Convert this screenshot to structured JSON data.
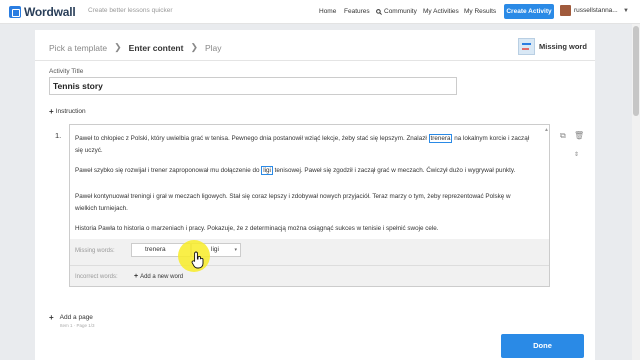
{
  "header": {
    "logo_text": "Wordwall",
    "tagline": "Create better lessons quicker",
    "nav": [
      "Home",
      "Features",
      "Community",
      "My Activities",
      "My Results"
    ],
    "create_label": "Create Activity",
    "username": "russellstanna...",
    "search_icon": "search-icon",
    "accent_color": "#2a8ae6"
  },
  "breadcrumb": [
    "Pick a template",
    "Enter content",
    "Play"
  ],
  "template_type": "Missing word",
  "activity": {
    "title_label": "Activity Title",
    "title_value": "Tennis story",
    "instruction_label": "Instruction"
  },
  "question": {
    "number": "1.",
    "paragraphs": [
      {
        "lines": [
          [
            {
              "text": "Paweł to chłopiec z Polski, który uwielbia grać w tenisa. Pewnego dnia postanowił wziąć lekcje, żeby stać się lepszym. Znalazł "
            },
            {
              "text": "trenera",
              "blank": true
            },
            {
              "text": " na lokalnym korcie i zaczął"
            }
          ],
          [
            {
              "text": "się uczyć."
            }
          ]
        ]
      },
      {
        "lines": [
          [
            {
              "text": "Paweł szybko się rozwijał i trener zaproponował mu dołączenie do "
            },
            {
              "text": "ligi",
              "blank": true
            },
            {
              "text": " tenisowej. Paweł się zgodził i zaczął grać w meczach. Ćwiczył dużo i wygrywał punkty."
            }
          ]
        ]
      },
      {
        "lines": [
          [
            {
              "text": "Paweł kontynuował treningi i grał w meczach ligowych. Stał się coraz lepszy i zdobywał nowych przyjaciół. Teraz marzy o tym, żeby reprezentować Polskę w"
            }
          ],
          [
            {
              "text": "wielkich turniejach."
            }
          ]
        ]
      },
      {
        "lines": [
          [
            {
              "text": "Historia Pawła to historia o marzeniach i pracy. Pokazuje, że z determinacją można osiągnąć sukces w tenisie i spełnić swoje cele."
            }
          ]
        ]
      }
    ],
    "missing_words_label": "Missing words:",
    "missing_words": [
      "trenera",
      "ligi"
    ],
    "incorrect_words_label": "Incorrect words:",
    "add_word_label": "Add a new word"
  },
  "footer": {
    "add_page_label": "Add a page",
    "add_page_sub": "Item 1 · Page 1/3",
    "done_label": "Done"
  }
}
